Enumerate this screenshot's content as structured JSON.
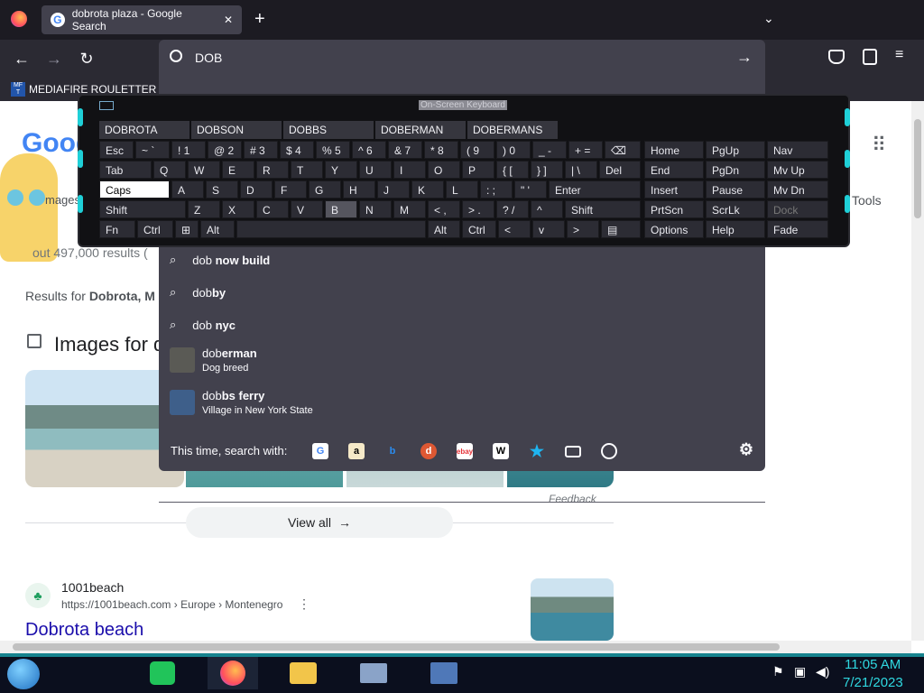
{
  "tab": {
    "title": "dobrota plaza - Google Search",
    "close": "✕",
    "new": "+"
  },
  "nav": {
    "back": "←",
    "forward": "→",
    "reload": "↻"
  },
  "url": {
    "value": "DOB",
    "go": "→"
  },
  "bookmarks": {
    "item": "MEDIAFIRE ROULETTER"
  },
  "osk": {
    "title": "On-Screen Keyboard",
    "predictions": [
      "DOBROTA",
      "DOBSON",
      "DOBBS",
      "DOBERMAN",
      "DOBERMANS"
    ],
    "row1": [
      "Esc",
      "~ `",
      "! 1",
      "@ 2",
      "# 3",
      "$ 4",
      "% 5",
      "^ 6",
      "& 7",
      "* 8",
      "( 9",
      ") 0",
      "_ -",
      "+ ="
    ],
    "row2": [
      "Tab",
      "Q",
      "W",
      "E",
      "R",
      "T",
      "Y",
      "U",
      "I",
      "O",
      "P",
      "{ [",
      "} ]",
      "| \\",
      "Del"
    ],
    "row3": [
      "Caps",
      "A",
      "S",
      "D",
      "F",
      "G",
      "H",
      "J",
      "K",
      "L",
      ": ;",
      "\" '",
      "Enter"
    ],
    "row4": [
      "Shift",
      "Z",
      "X",
      "C",
      "V",
      "B",
      "N",
      "M",
      "< ,",
      "> .",
      "? /",
      "^",
      "Shift"
    ],
    "row5": [
      "Fn",
      "Ctrl",
      "⊞",
      "Alt",
      "",
      "Alt",
      "Ctrl",
      "<",
      "v",
      ">",
      "▤"
    ],
    "nav": [
      [
        "Home",
        "PgUp",
        "Nav"
      ],
      [
        "End",
        "PgDn",
        "Mv Up"
      ],
      [
        "Insert",
        "Pause",
        "Mv Dn"
      ],
      [
        "PrtScn",
        "ScrLk",
        "Dock"
      ],
      [
        "Options",
        "Help",
        "Fade"
      ]
    ]
  },
  "suggestions": [
    {
      "pre": "dob",
      "bold": " now build"
    },
    {
      "pre": "dob",
      "bold": "by"
    },
    {
      "pre": "dob",
      "bold": " nyc"
    },
    {
      "pre": "dob",
      "bold": "erman",
      "sub": "Dog breed"
    },
    {
      "pre": "dob",
      "bold": "bs ferry",
      "sub": "Village in New York State"
    }
  ],
  "search_with": "This time, search with:",
  "page": {
    "logo": "Goog",
    "images_tab": "mages",
    "results_count": "out 497,000 results (",
    "results_for_pre": "Results for ",
    "results_for_bold": "Dobrota, M",
    "images_heading": "Images for d",
    "tools": "Tools",
    "feedback": "Feedback",
    "view_all": "View all",
    "site_name": "1001beach",
    "site_url": "https://1001beach.com › Europe › Montenegro",
    "result_title": "Dobrota beach"
  },
  "clock": {
    "time": "11:05 AM",
    "date": "7/21/2023"
  },
  "colors": {
    "accent": "#1fd0d8",
    "link": "#1a0dab"
  }
}
